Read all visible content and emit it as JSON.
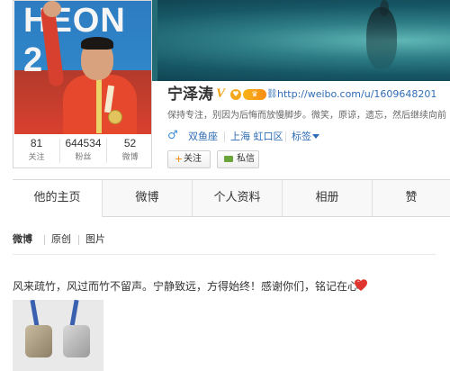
{
  "profile": {
    "name": "宁泽涛",
    "verified_mark": "V",
    "url": "http://weibo.com/u/1609648201",
    "bio": "保持专注，别因为后悔而放慢脚步。微笑，原谅，遗忘，然后继续向前",
    "gender_icon": "male-icon",
    "gender_symbol": "♂",
    "zodiac": "双鱼座",
    "location": "上海 虹口区",
    "tags_label": "标签",
    "photo_text": "HEON 2",
    "follow_button": "关注",
    "follow_plus": "+",
    "message_button": "私信"
  },
  "stats": [
    {
      "value": "81",
      "label": "关注"
    },
    {
      "value": "644534",
      "label": "粉丝"
    },
    {
      "value": "52",
      "label": "微博"
    }
  ],
  "tabs": [
    {
      "label": "他的主页",
      "active": true
    },
    {
      "label": "微博"
    },
    {
      "label": "个人资料"
    },
    {
      "label": "相册"
    },
    {
      "label": "赞"
    }
  ],
  "feed_filters": [
    {
      "label": "微博",
      "active": true
    },
    {
      "label": "原创"
    },
    {
      "label": "图片"
    }
  ],
  "post": {
    "text": "风来疏竹，风过而竹不留声。宁静致远，方得始终！感谢你们，铭记在心！",
    "emoji": "heart-icon",
    "image": "medals-photo"
  },
  "colors": {
    "link": "#2f6db5",
    "verified": "#f3a20b",
    "heart": "#e0342f"
  }
}
